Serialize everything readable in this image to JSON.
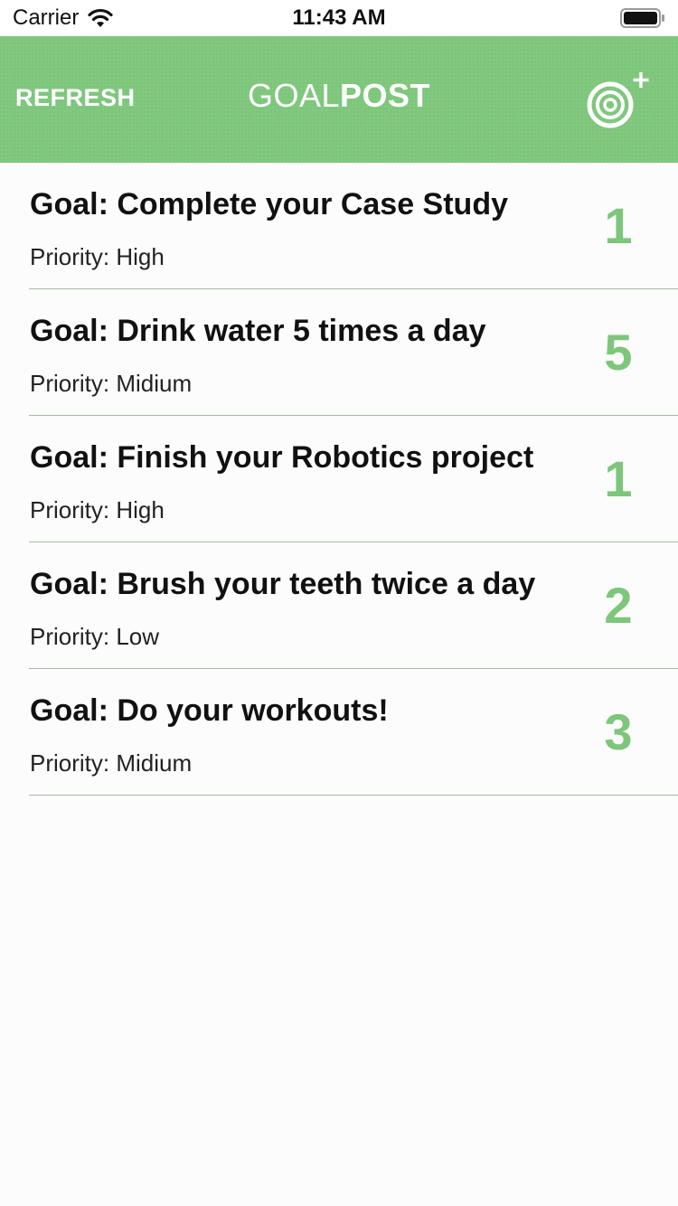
{
  "status_bar": {
    "carrier": "Carrier",
    "time": "11:43 AM"
  },
  "nav_bar": {
    "refresh_label": "REFRESH",
    "title_light": "GOAL",
    "title_bold": "POST",
    "add_icon": "target-plus-icon",
    "bar_color": "#7dc67b"
  },
  "goals": [
    {
      "description": "Goal: Complete your Case Study",
      "priority": "Priority: High",
      "progress": "1"
    },
    {
      "description": "Goal: Drink water 5 times a day",
      "priority": "Priority: Midium",
      "progress": "5"
    },
    {
      "description": "Goal: Finish your Robotics project",
      "priority": "Priority: High",
      "progress": "1"
    },
    {
      "description": "Goal: Brush your teeth twice a day",
      "priority": "Priority: Low",
      "progress": "2"
    },
    {
      "description": "Goal: Do your workouts!",
      "priority": "Priority: Midium",
      "progress": "3"
    }
  ],
  "colors": {
    "accent": "#7dc67b",
    "background": "#fcfcfc",
    "separator": "#a8bba2"
  }
}
